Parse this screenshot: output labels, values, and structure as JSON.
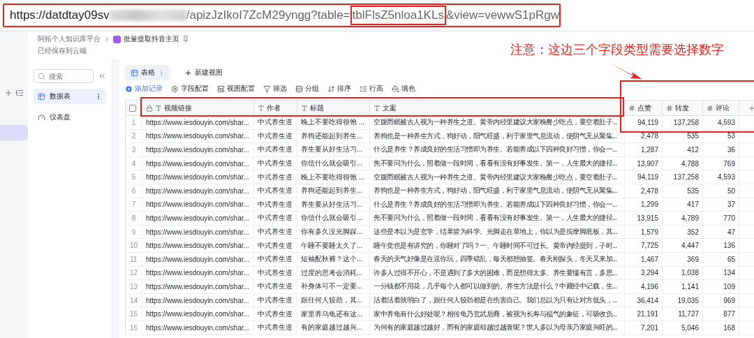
{
  "address_bar": {
    "url_start": "https://datdtay09sv",
    "url_middle": "/apizJzIkoI7ZcM29yngg?table=",
    "url_highlight": "tblFlsZ5nloa1KLs",
    "url_end": "&view=vewwS1pRgw"
  },
  "breadcrumb": {
    "workspace": "阿拓个人知识库平台",
    "document": "批量提取抖音主页",
    "status": "已经保存到云端"
  },
  "annotation": {
    "note": "注意：这边三个字段类型需要选择数字"
  },
  "sidebar": {
    "search": {
      "placeholder": "搜索"
    },
    "items": [
      {
        "label": "数据表",
        "kind": "table",
        "selected": true
      },
      {
        "label": "仪表盘",
        "kind": "dashboard",
        "selected": false
      }
    ]
  },
  "view_tabs": [
    {
      "label": "表格",
      "selected": true
    },
    {
      "label": "新建视图",
      "selected": false
    }
  ],
  "toolbar": [
    {
      "label": "添加记录",
      "kind": "add"
    },
    {
      "label": "字段配置",
      "kind": "fields"
    },
    {
      "label": "视图配置",
      "kind": "view"
    },
    {
      "label": "筛选",
      "kind": "filter"
    },
    {
      "label": "分组",
      "kind": "group"
    },
    {
      "label": "排序",
      "kind": "sort"
    },
    {
      "label": "行高",
      "kind": "height"
    },
    {
      "label": "填色",
      "kind": "fill"
    }
  ],
  "table": {
    "select_all": {
      "checked": false
    },
    "columns": [
      {
        "label": "视频链接",
        "kind": "text",
        "locked": true
      },
      {
        "label": "作者",
        "kind": "text",
        "locked": false
      },
      {
        "label": "标题",
        "kind": "text",
        "locked": false
      },
      {
        "label": "文案",
        "kind": "text",
        "locked": false
      },
      {
        "label": "点赞",
        "kind": "number",
        "locked": false
      },
      {
        "label": "转发",
        "kind": "number",
        "locked": false
      },
      {
        "label": "评论",
        "kind": "number",
        "locked": false
      }
    ],
    "rows": [
      {
        "index": "1",
        "cells": [
          "https://www.iesdouyin.com/shar...",
          "中式养生道",
          "晚上不要吃得很饱 ...",
          "空腹而眠被古人视为一种养生之道。黄帝内经里建议大家晚餐少吃点，要空着肚子...",
          "94,119",
          "137,258",
          "4,593"
        ]
      },
      {
        "index": "2",
        "cells": [
          "https://www.iesdouyin.com/shar...",
          "中式养生道",
          "养狗还能起到养生...",
          "养狗也是一种养生方式，狗好动，阳气旺盛，利于家里气息流动，使阴气无从聚集...",
          "2,478",
          "535",
          "53"
        ]
      },
      {
        "index": "3",
        "cells": [
          "https://www.iesdouyin.com/shar...",
          "中式养生道",
          "养生要从好生活习...",
          "什么是养生？养成良好的生活习惯即为养生。若能养成以下四种良好习惯，你会一...",
          "1,287",
          "412",
          "36"
        ]
      },
      {
        "index": "4",
        "cells": [
          "https://www.iesdouyin.com/shar...",
          "中式养生道",
          "你信什么就会吸引...",
          "先不要问为什么，照着做一段时间，看看有没有好事发生。第一，人生最大的捷径...",
          "13,907",
          "4,788",
          "769"
        ]
      },
      {
        "index": "5",
        "cells": [
          "https://www.iesdouyin.com/shar...",
          "中式养生道",
          "晚上不要吃得很饱 ...",
          "空腹而眠被古人视为一种养生之道。黄帝内经里建议大家晚餐少吃点，要空着肚子...",
          "94,119",
          "137,258",
          "4,593"
        ]
      },
      {
        "index": "6",
        "cells": [
          "https://www.iesdouyin.com/shar...",
          "中式养生道",
          "养狗还能起到养生...",
          "养狗也是一种养生方式，狗好动，阳气旺盛，利于家里气息流动，使阴气无从聚集...",
          "2,478",
          "535",
          "50"
        ]
      },
      {
        "index": "7",
        "cells": [
          "https://www.iesdouyin.com/shar...",
          "中式养生道",
          "养生要从好生活习...",
          "什么是养生？养成良好的生活习惯即为养生。若能养成以下四种良好习惯，你会一...",
          "1,299",
          "417",
          "37"
        ]
      },
      {
        "index": "8",
        "cells": [
          "https://www.iesdouyin.com/shar...",
          "中式养生道",
          "你信什么就会吸引...",
          "先不要问为什么，照着做一段时间，看看有没有好事发生。第一，人生最大的捷径...",
          "13,915",
          "4,789",
          "770"
        ]
      },
      {
        "index": "9",
        "cells": [
          "https://www.iesdouyin.com/shar...",
          "中式养生道",
          "你有多久没光脚踩...",
          "这些是本以为是玄学，结果皆为科学。光脚走在草地上，你以为是按摩脚底板，其...",
          "1,579",
          "352",
          "47"
        ]
      },
      {
        "index": "10",
        "cells": [
          "https://www.iesdouyin.com/shar...",
          "中式养生道",
          "午睡不要睡太久了...",
          "睡午觉也是有讲究的，你睡对了吗？一、午睡时间不可过长。黄帝内经提到，子时...",
          "7,725",
          "4,447",
          "136"
        ]
      },
      {
        "index": "11",
        "cells": [
          "https://www.iesdouyin.com/shar...",
          "中式养生道",
          "短袖配秋裤？这个...",
          "春天的天气好像是在逗你玩，四季错乱，每天都想抽签。春天刚探头，冬天又来加...",
          "1,467",
          "369",
          "65"
        ]
      },
      {
        "index": "12",
        "cells": [
          "https://www.iesdouyin.com/shar...",
          "中式养生道",
          "过度的思考会消耗...",
          "许多人过得不开心，不是遇到了多大的困难，而是想得太多。养生要懂有言，多思...",
          "3,294",
          "1,038",
          "134"
        ]
      },
      {
        "index": "13",
        "cells": [
          "https://www.iesdouyin.com/shar...",
          "中式养生道",
          "补身体可不一定要...",
          "一分钱都不用花，几乎每个人都可以做到的。养生方法是什么？中藏经中记载，生...",
          "4,196",
          "1,141",
          "109"
        ]
      },
      {
        "index": "14",
        "cells": [
          "https://www.iesdouyin.com/shar...",
          "中式养生道",
          "跟任何人较劲，其...",
          "活着活着就明白了，跟任何人较劲都是在伤害自己。我们总以为只有让对方低头，...",
          "36,414",
          "19,035",
          "969"
        ]
      },
      {
        "index": "15",
        "cells": [
          "https://www.iesdouyin.com/shar...",
          "中式养生道",
          "家里养乌龟还有这...",
          "家中养龟有什么好处呢？相传龟乃玄武后裔，被视为长寿与福气的象征，可吸收负...",
          "21,191",
          "11,727",
          "877"
        ]
      },
      {
        "index": "16",
        "cells": [
          "https://www.iesdouyin.com/shar...",
          "中式养生道",
          "有的家庭越过越兴...",
          "为何有的家庭越过越好，而有的家庭却越过越衰呢？世人多以为母亲乃家庭兴旺的...",
          "7,201",
          "5,046",
          "168"
        ]
      }
    ]
  }
}
